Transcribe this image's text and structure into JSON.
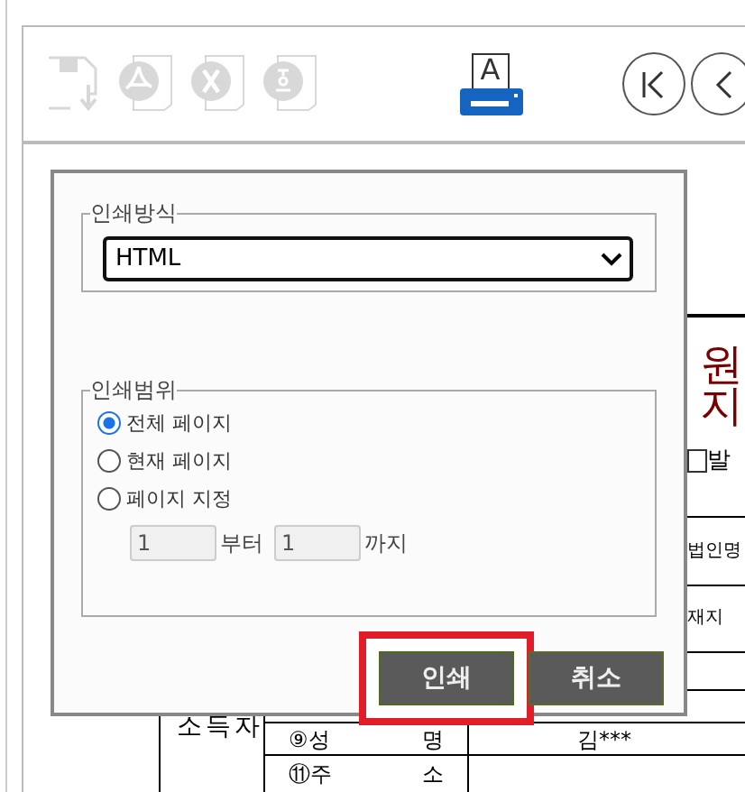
{
  "toolbar": {
    "buttons": [
      {
        "kind": "save",
        "disabled": true
      },
      {
        "kind": "pdf",
        "disabled": true
      },
      {
        "kind": "excel",
        "disabled": true
      },
      {
        "kind": "hwp",
        "disabled": true
      },
      {
        "kind": "print",
        "disabled": false,
        "label": "A"
      },
      {
        "kind": "first",
        "disabled": false
      },
      {
        "kind": "prev",
        "disabled": false
      }
    ]
  },
  "document": {
    "title_lines": [
      "원",
      "지"
    ],
    "issue_checkbox": {
      "label": "발",
      "checked": false
    },
    "side_rows": [
      "법인명",
      "재지"
    ],
    "table": {
      "group": "소득자",
      "rows": [
        {
          "label": "⑨성",
          "label_2": "명",
          "value": "김***"
        },
        {
          "label": "⑪주",
          "label_2": "소"
        }
      ]
    }
  },
  "print_dialog": {
    "print_method": {
      "legend": "인쇄방식",
      "value": "HTML"
    },
    "print_range": {
      "legend": "인쇄범위",
      "options": [
        {
          "label": "전체 페이지",
          "selected": true
        },
        {
          "label": "현재 페이지",
          "selected": false
        },
        {
          "label": "페이지 지정",
          "selected": false
        }
      ],
      "from": {
        "value": "1",
        "label": "부터",
        "disabled": true
      },
      "to": {
        "value": "1",
        "label": "까지",
        "disabled": true
      }
    },
    "buttons": [
      {
        "label": "인쇄",
        "highlighted": true
      },
      {
        "label": "취소",
        "highlighted": false
      }
    ]
  }
}
